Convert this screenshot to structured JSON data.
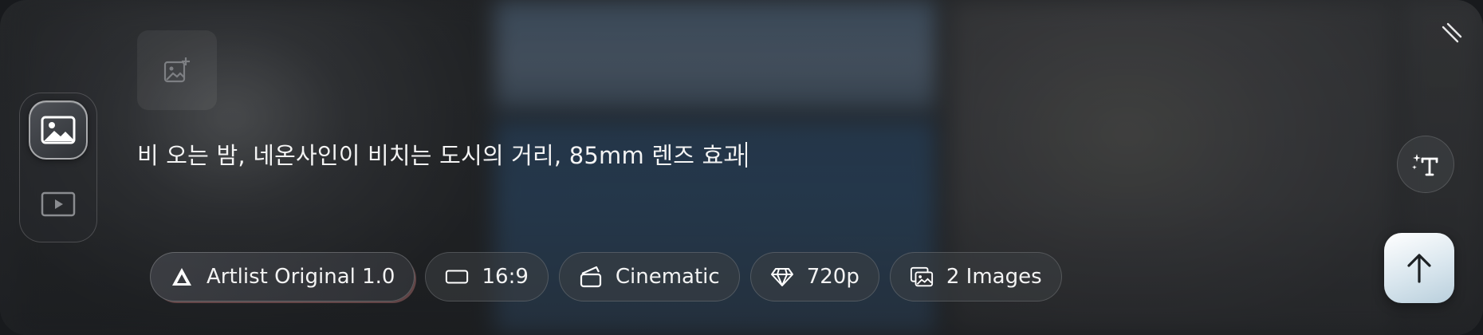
{
  "prompt": {
    "text": "비 오는 밤, 네온사인이 비치는 도시의 거리, 85mm 렌즈 효과"
  },
  "mode_switch": [
    {
      "icon": "image-icon",
      "active": true
    },
    {
      "icon": "video-icon",
      "active": false
    }
  ],
  "toolbar": {
    "model": {
      "label": "Artlist Original 1.0",
      "icon": "artlist-logo-icon"
    },
    "aspect": {
      "label": "16:9",
      "icon": "aspect-ratio-icon"
    },
    "style": {
      "label": "Cinematic",
      "icon": "clapperboard-icon"
    },
    "quality": {
      "label": "720p",
      "icon": "diamond-icon"
    },
    "count": {
      "label": "2 Images",
      "icon": "images-icon"
    }
  },
  "colors": {
    "accent_glow": "#e68c8c",
    "submit_bg": "#d9e6ee"
  }
}
